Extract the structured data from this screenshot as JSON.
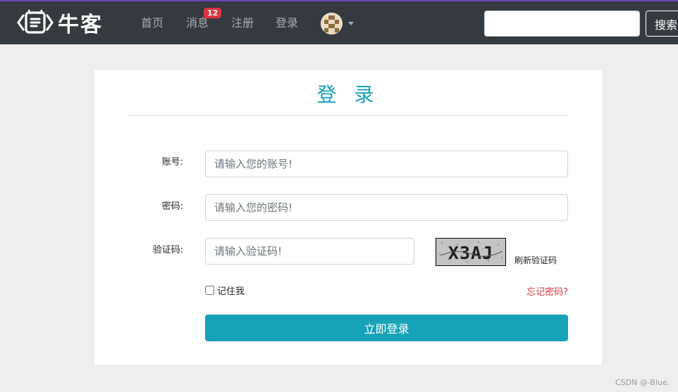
{
  "navbar": {
    "brand_text": "牛客",
    "logo_icon": "nowcoder-logo-icon",
    "items": [
      {
        "label": "首页"
      },
      {
        "label": "消息"
      },
      {
        "label": "注册"
      },
      {
        "label": "登录"
      }
    ],
    "message_badge": "12",
    "avatar_icon": "user-avatar-icon",
    "search": {
      "value": "",
      "button_label": "搜索"
    }
  },
  "login": {
    "title": "登 录",
    "account": {
      "label": "账号:",
      "placeholder": "请输入您的账号!",
      "value": ""
    },
    "password": {
      "label": "密码:",
      "placeholder": "请输入您的密码!",
      "value": ""
    },
    "captcha": {
      "label": "验证码:",
      "placeholder": "请输入验证码!",
      "value": "",
      "image_text": "X3AJ",
      "refresh_label": "刷新验证码"
    },
    "remember_label": "记住我",
    "remember_checked": false,
    "forgot_label": "忘记密码?",
    "submit_label": "立即登录"
  },
  "watermark": "CSDN @-Blue.",
  "colors": {
    "navbar_bg": "#343a40",
    "accent": "#17a2b8",
    "danger": "#dc3545",
    "page_bg": "#eeeeee"
  }
}
